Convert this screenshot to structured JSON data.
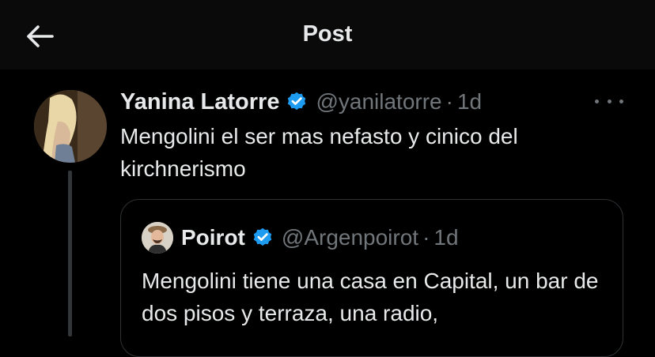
{
  "header": {
    "title": "Post",
    "back_icon": "arrow-left-icon"
  },
  "post": {
    "author_name": "Yanina Latorre",
    "handle": "@yanilatorre",
    "separator": "·",
    "time": "1d",
    "verified_icon": "verified-badge-icon",
    "more_icon": "more-horizontal-icon",
    "text": "Mengolini el ser mas nefasto y cinico del kirchnerismo"
  },
  "quote": {
    "author_name": "Poirot",
    "handle": "@Argenpoirot",
    "separator": "·",
    "time": "1d",
    "verified_icon": "verified-badge-icon",
    "text": "Mengolini tiene una casa en Capital, un bar de dos pisos y terraza, una radio,"
  },
  "colors": {
    "background": "#000000",
    "header_background": "#0a0a0a",
    "text_primary": "#e7e9ea",
    "text_secondary": "#71767b",
    "verified_blue": "#1d9bf0",
    "border": "#2f3336"
  }
}
